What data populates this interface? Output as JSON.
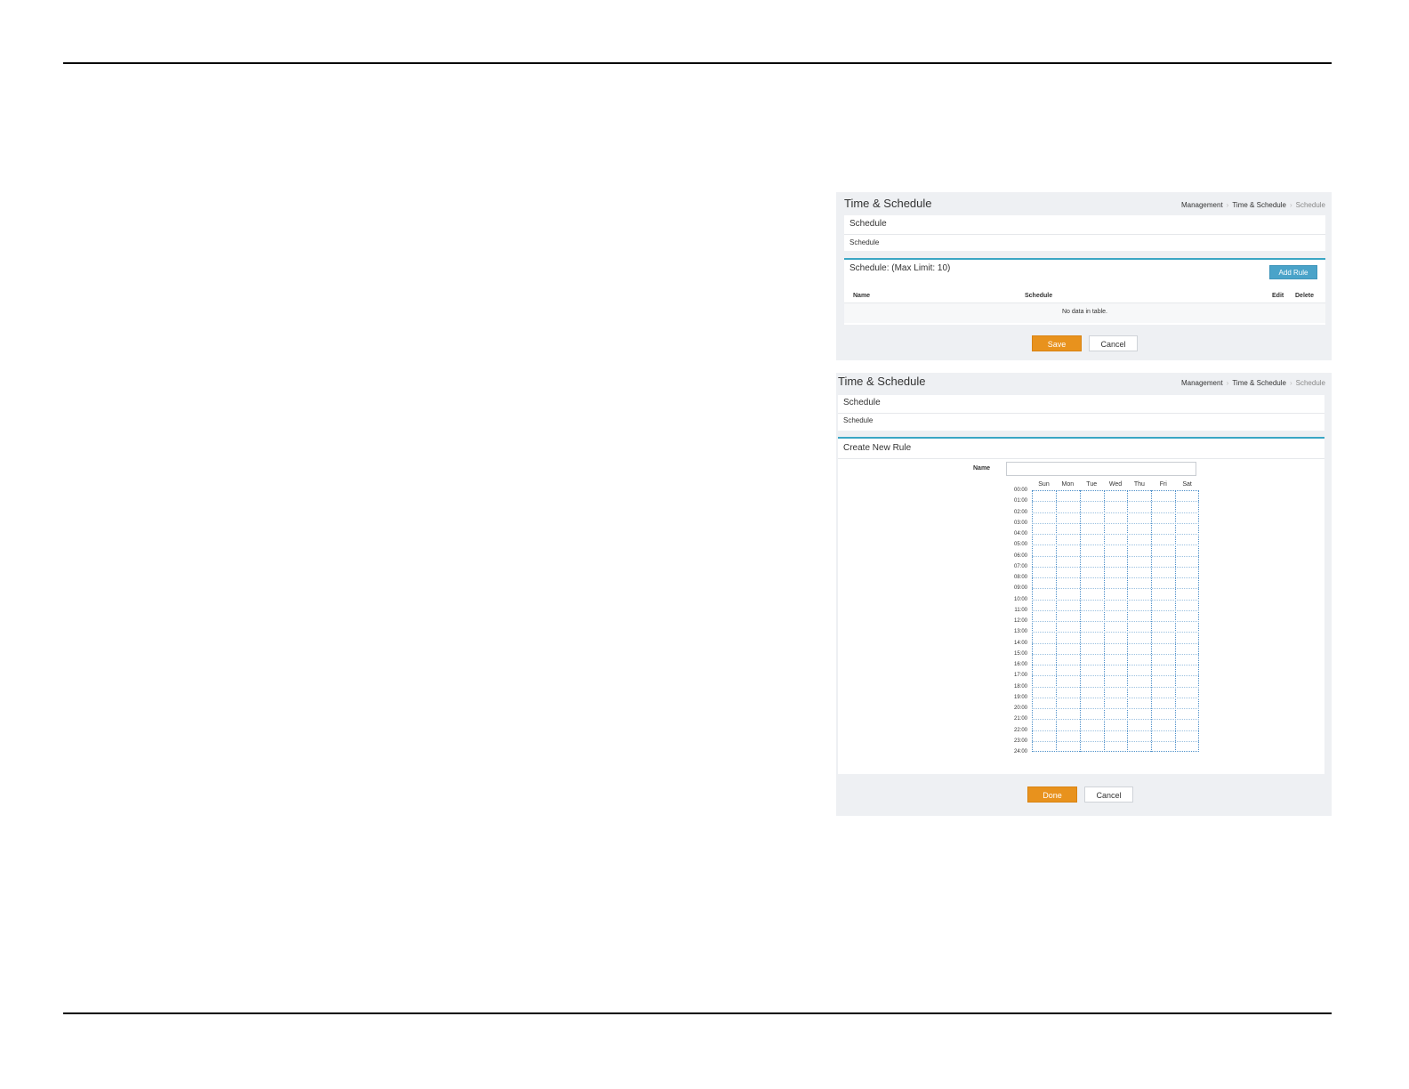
{
  "panel1": {
    "title": "Time & Schedule",
    "breadcrumb": [
      "Management",
      "Time & Schedule",
      "Schedule"
    ],
    "section": {
      "header": "Schedule",
      "sub": "Schedule"
    },
    "table": {
      "title": "Schedule: (Max Limit: 10)",
      "add_label": "Add Rule",
      "columns": [
        "Name",
        "Schedule",
        "Edit",
        "Delete"
      ],
      "empty": "No data in table."
    },
    "save_label": "Save",
    "cancel_label": "Cancel"
  },
  "panel2": {
    "title": "Time & Schedule",
    "breadcrumb": [
      "Management",
      "Time & Schedule",
      "Schedule"
    ],
    "section": {
      "header": "Schedule",
      "sub": "Schedule"
    },
    "create_title": "Create New Rule",
    "name_label": "Name",
    "name_value": "",
    "days": [
      "Sun",
      "Mon",
      "Tue",
      "Wed",
      "Thu",
      "Fri",
      "Sat"
    ],
    "hours": [
      "00:00",
      "01:00",
      "02:00",
      "03:00",
      "04:00",
      "05:00",
      "06:00",
      "07:00",
      "08:00",
      "09:00",
      "10:00",
      "11:00",
      "12:00",
      "13:00",
      "14:00",
      "15:00",
      "16:00",
      "17:00",
      "18:00",
      "19:00",
      "20:00",
      "21:00",
      "22:00",
      "23:00",
      "24:00"
    ],
    "done_label": "Done",
    "cancel_label": "Cancel"
  },
  "colors": {
    "accent": "#e8921d",
    "teal": "#3aa6c4",
    "add_button": "#4aa3c9",
    "panel_bg": "#eef0f3",
    "grid": "#4d8fc9"
  }
}
